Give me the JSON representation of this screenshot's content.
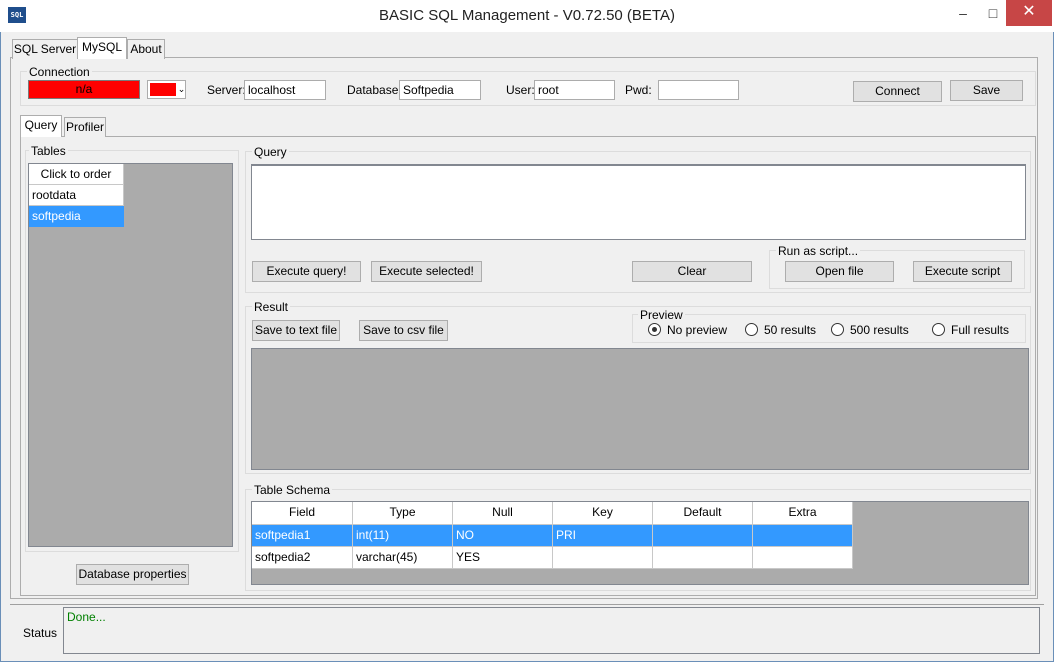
{
  "window": {
    "title": "BASIC SQL Management  - V0.72.50 (BETA)",
    "icon_text": "SQL",
    "minimize": "–",
    "maximize": "□",
    "close": "✕"
  },
  "main_tabs": [
    "SQL Server",
    "MySQL",
    "About"
  ],
  "connection": {
    "label": "Connection",
    "status_value": "n/a",
    "status_color": "#ff0000",
    "server_label": "Server:",
    "server_value": "localhost",
    "database_label": "Database:",
    "database_value": "Softpedia",
    "user_label": "User:",
    "user_value": "root",
    "pwd_label": "Pwd:",
    "pwd_value": "",
    "connect_button": "Connect",
    "save_button": "Save"
  },
  "sub_tabs": [
    "Query",
    "Profiler"
  ],
  "tables": {
    "label": "Tables",
    "header": "Click to order",
    "items": [
      "rootdata",
      "softpedia"
    ],
    "selected": "softpedia",
    "db_properties_button": "Database properties"
  },
  "query": {
    "label": "Query",
    "text": "",
    "execute_query_button": "Execute query!",
    "execute_selected_button": "Execute selected!",
    "clear_button": "Clear",
    "run_as_script_label": "Run as script...",
    "open_file_button": "Open file",
    "execute_script_button": "Execute script"
  },
  "result": {
    "label": "Result",
    "save_text_button": "Save to text file",
    "save_csv_button": "Save to csv file",
    "preview_label": "Preview",
    "preview_options": [
      "No preview",
      "50 results",
      "500 results",
      "Full results"
    ],
    "preview_selected": "No preview"
  },
  "schema": {
    "label": "Table Schema",
    "columns": [
      "Field",
      "Type",
      "Null",
      "Key",
      "Default",
      "Extra"
    ],
    "rows": [
      [
        "softpedia1",
        "int(11)",
        "NO",
        "PRI",
        "",
        ""
      ],
      [
        "softpedia2",
        "varchar(45)",
        "YES",
        "",
        "",
        ""
      ]
    ]
  },
  "status": {
    "label": "Status",
    "text": "Done..."
  },
  "colors": {
    "selection": "#3399ff",
    "status_text": "#008000",
    "close_button": "#c74646"
  }
}
